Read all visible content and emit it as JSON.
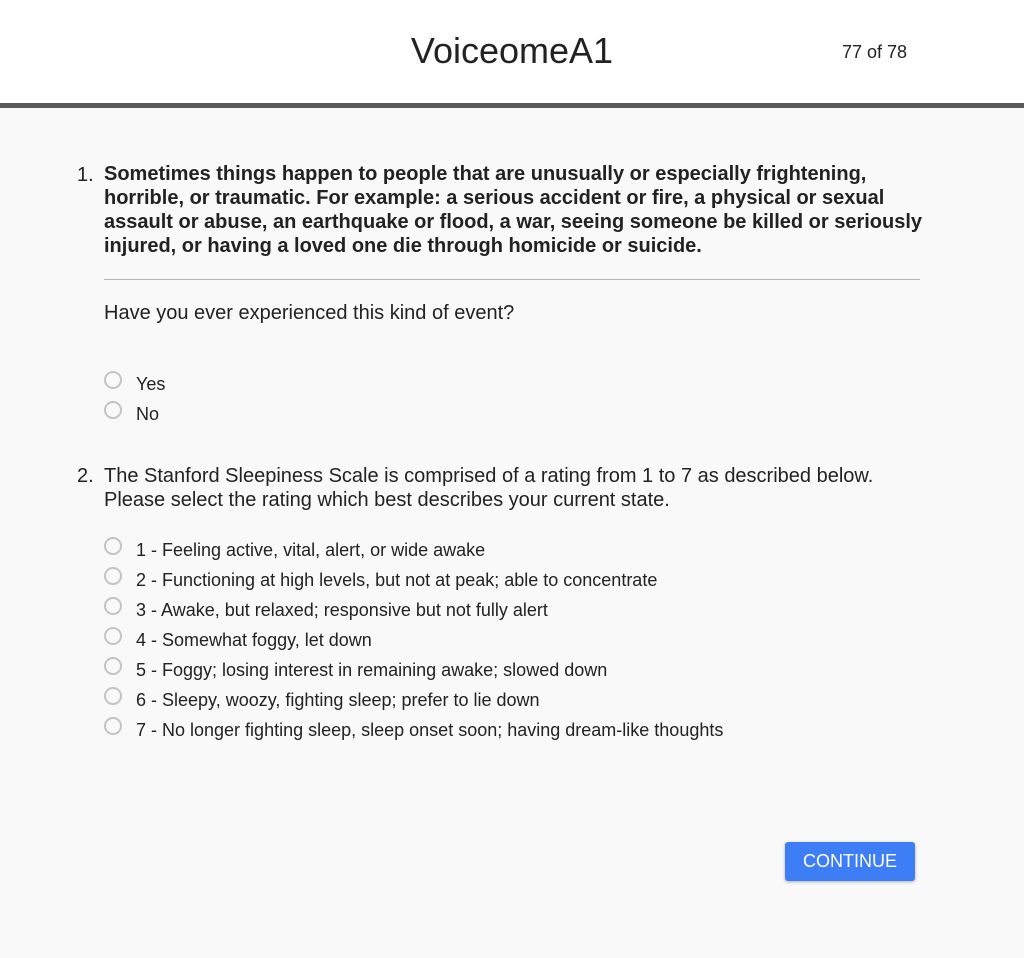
{
  "header": {
    "title": "VoiceomeA1",
    "page_counter": "77 of 78"
  },
  "questions": [
    {
      "number": "1.",
      "prompt": "Sometimes things happen to people that are unusually or especially frightening, horrible, or traumatic. For example: a serious accident or fire, a physical or sexual assault or abuse, an earthquake or flood, a war, seeing someone be killed or seriously injured, or having a loved one die through homicide or suicide.",
      "subquestion": "Have you ever experienced this kind of event?",
      "options": [
        "Yes",
        "No"
      ]
    },
    {
      "number": "2.",
      "prompt": "The Stanford Sleepiness Scale is comprised of a rating from 1 to 7 as described below. Please select the rating which best describes your current state.",
      "options": [
        "1 - Feeling active, vital, alert, or wide awake",
        "2 - Functioning at high levels, but not at peak; able to concentrate",
        "3 - Awake, but relaxed; responsive but not fully alert",
        "4 - Somewhat foggy, let down",
        "5 - Foggy; losing interest in remaining awake; slowed down",
        "6 - Sleepy, woozy, fighting sleep; prefer to lie down",
        "7 - No longer fighting sleep, sleep onset soon; having dream-like thoughts"
      ]
    }
  ],
  "footer": {
    "continue_label": "CONTINUE"
  },
  "colors": {
    "accent": "#3d7ef7",
    "header_border": "#5a5a5a",
    "background": "#f9f9f9",
    "radio_border": "#c4c4c4"
  }
}
